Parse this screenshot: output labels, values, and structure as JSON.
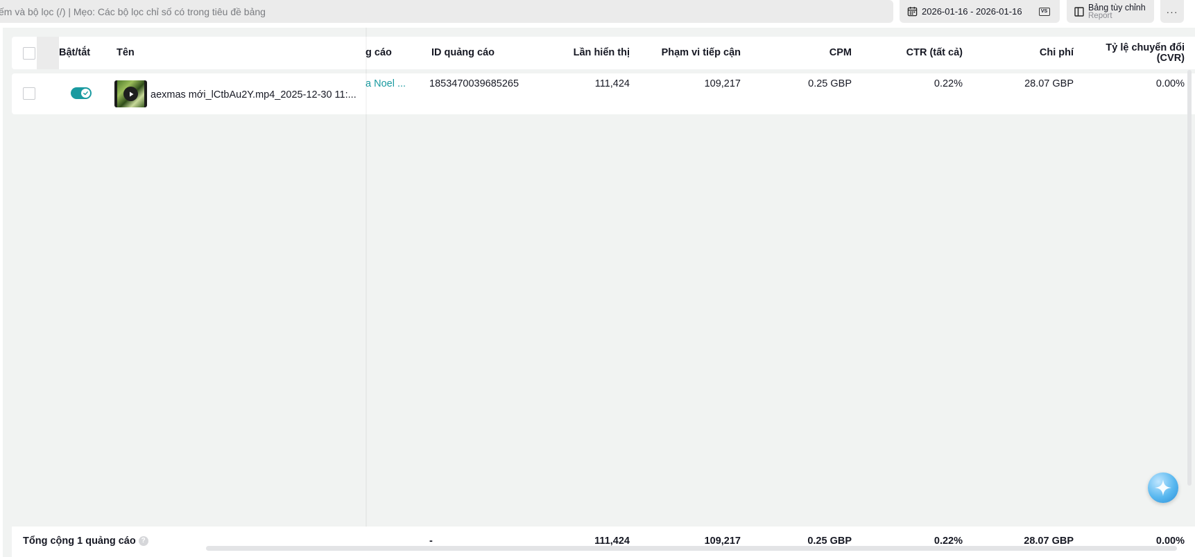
{
  "toolbar": {
    "search_placeholder": "ếm và bộ lọc (/) | Mẹo: Các bộ lọc chỉ số có trong tiêu đề bảng",
    "date_range": "2026-01-16 - 2026-01-16",
    "compare_badge": "VS",
    "custom_table_label": "Bảng tùy chỉnh",
    "custom_table_sublabel": "Report",
    "more_label": "···"
  },
  "table": {
    "headers": {
      "toggle": "Bật/tắt",
      "name": "Tên",
      "ad_group": "g cáo",
      "ad_id": "ID quảng cáo",
      "impressions": "Lần hiển thị",
      "reach": "Phạm vi tiếp cận",
      "cpm": "CPM",
      "ctr": "CTR (tất cả)",
      "cost": "Chi phí",
      "cvr_line1": "Tỷ lệ chuyển đổi",
      "cvr_line2": "(CVR)"
    },
    "rows": [
      {
        "toggle_on": true,
        "name": "aexmas mới_lCtbAu2Y.mp4_2025-12-30 11:...",
        "ad_group": "a Noel ...",
        "ad_id": "1853470039685265",
        "impressions": "111,424",
        "reach": "109,217",
        "cpm": "0.25 GBP",
        "ctr": "0.22%",
        "cost": "28.07 GBP",
        "cvr": "0.00%"
      }
    ],
    "footer": {
      "label": "Tổng cộng 1 quảng cáo",
      "help": "?",
      "ad_id": "-",
      "impressions": "111,424",
      "reach": "109,217",
      "cpm": "0.25 GBP",
      "ctr": "0.22%",
      "cost": "28.07 GBP",
      "cvr": "0.00%"
    }
  },
  "colors": {
    "accent": "#1a9aa0",
    "page_bg": "#f1f3f2"
  }
}
